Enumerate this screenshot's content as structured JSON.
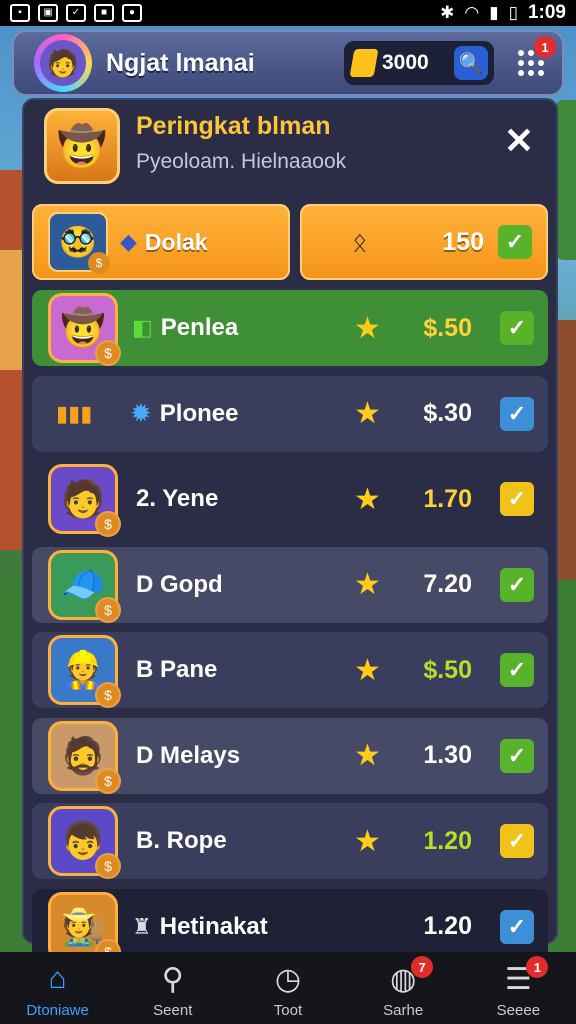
{
  "status_bar": {
    "time": "1:09",
    "left_icons": [
      "notification-icon",
      "image-icon",
      "check-icon",
      "square-icon",
      "app-icon"
    ],
    "right_icons": [
      "bluetooth-icon",
      "wifi-icon",
      "signal-icon",
      "battery-icon"
    ]
  },
  "header": {
    "title": "Ngjat lmanai",
    "coins": "3000"
  },
  "panel": {
    "title": "Peringkat blman",
    "subtitle": "Pyeoloam. Hielnaaook",
    "top_left_label": "Dolak",
    "top_right_value": "150"
  },
  "rows": [
    {
      "name": "Penlea",
      "value": "$.50",
      "check": "green",
      "bg": "#3f8f36",
      "value_color": "#ffd23a"
    },
    {
      "name": "Plonee",
      "value": "$.30",
      "check": "blue",
      "bg": "#3a3d5c",
      "value_color": "#ffffff"
    },
    {
      "name": "2. Yene",
      "value": "1.70",
      "check": "yellow",
      "bg": "#2a2d45",
      "value_color": "#ffd23a"
    },
    {
      "name": "D Gopd",
      "value": "7.20",
      "check": "green",
      "bg": "#474a66",
      "value_color": "#ffffff"
    },
    {
      "name": "B Pane",
      "value": "$.50",
      "check": "green",
      "bg": "#3a3d5c",
      "value_color": "#b4e02a"
    },
    {
      "name": "D Melays",
      "value": "1.30",
      "check": "green",
      "bg": "#474a66",
      "value_color": "#ffffff"
    },
    {
      "name": "B. Rope",
      "value": "1.20",
      "check": "yellow",
      "bg": "#3a3d5c",
      "value_color": "#b4e02a"
    },
    {
      "name": "Hetinakat",
      "value": "1.20",
      "check": "blue",
      "bg": "#1f2136",
      "value_color": "#ffffff"
    }
  ],
  "nav": [
    {
      "label": "Dtoniawe",
      "icon": "home-icon",
      "active": true
    },
    {
      "label": "Seent",
      "icon": "search-icon",
      "active": false
    },
    {
      "label": "Toot",
      "icon": "clock-icon",
      "active": false
    },
    {
      "label": "Sarhe",
      "icon": "globe-icon",
      "active": false,
      "badge": "7"
    },
    {
      "label": "Seeee",
      "icon": "menu-icon",
      "active": false,
      "badge": "1"
    }
  ],
  "header_badge": "1"
}
